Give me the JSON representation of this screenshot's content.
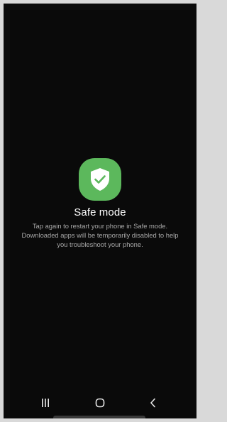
{
  "safe_mode": {
    "icon": "shield-check-icon",
    "title": "Safe mode",
    "description": "Tap again to restart your phone in Safe mode. Downloaded apps will be temporarily disabled to help you troubleshoot your phone."
  },
  "navigation": {
    "recents_icon": "recents-icon",
    "home_icon": "home-icon",
    "back_icon": "back-icon"
  },
  "colors": {
    "background": "#0a0a0a",
    "icon_green": "#5cb85c",
    "title": "#ffffff",
    "description": "#a8a8a8",
    "nav_icons": "#e8e8e8"
  }
}
